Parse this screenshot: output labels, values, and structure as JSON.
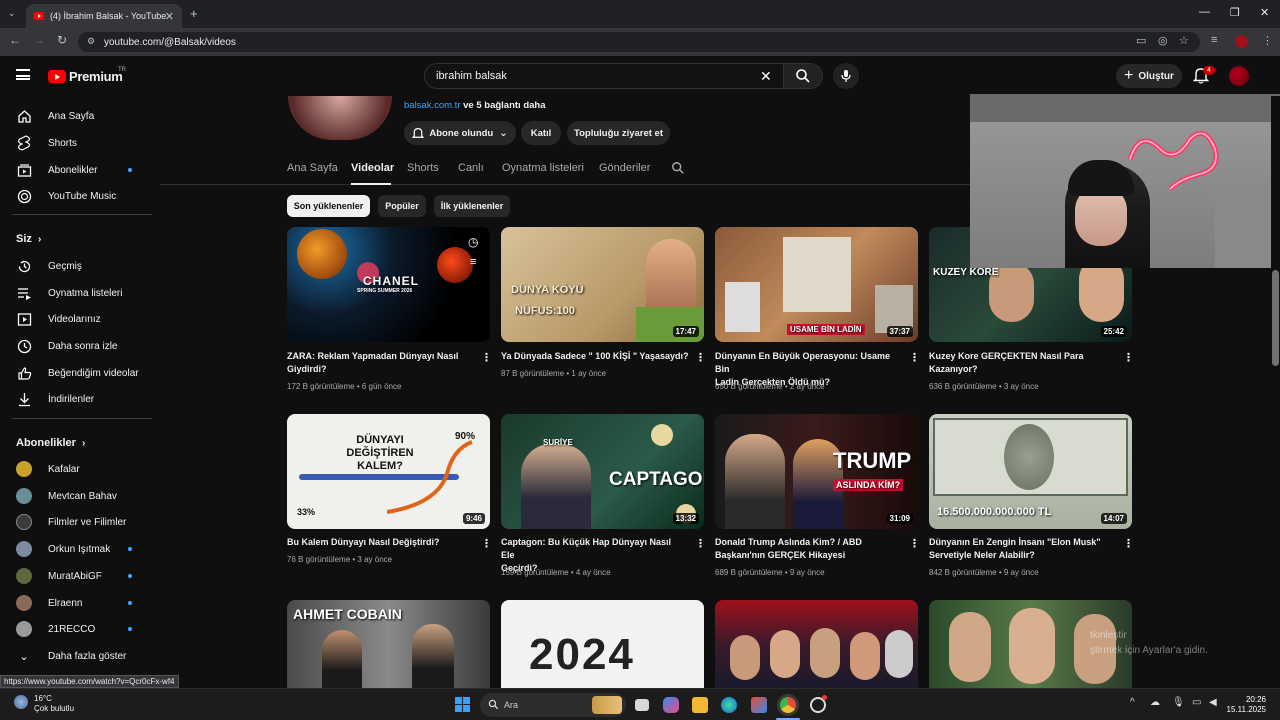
{
  "browser": {
    "tab_title": "(4) İbrahim Balsak - YouTube",
    "url": "youtube.com/@Balsak/videos",
    "status_url": "https://www.youtube.com/watch?v=Qcr0cFx-wf4"
  },
  "header": {
    "logo_text": "Premium",
    "logo_region": "TR",
    "search_value": "ibrahim balsak",
    "create_label": "Oluştur",
    "notification_count": "4"
  },
  "sidebar": {
    "main": [
      {
        "label": "Ana Sayfa",
        "icon": "home-icon"
      },
      {
        "label": "Shorts",
        "icon": "shorts-icon"
      },
      {
        "label": "Abonelikler",
        "icon": "subscriptions-icon"
      },
      {
        "label": "YouTube Music",
        "icon": "music-icon"
      }
    ],
    "you_heading": "Siz",
    "you": [
      {
        "label": "Geçmiş",
        "icon": "history-icon"
      },
      {
        "label": "Oynatma listeleri",
        "icon": "playlists-icon"
      },
      {
        "label": "Videolarınız",
        "icon": "your-videos-icon"
      },
      {
        "label": "Daha sonra izle",
        "icon": "watch-later-icon"
      },
      {
        "label": "Beğendiğim videolar",
        "icon": "liked-icon"
      },
      {
        "label": "İndirilenler",
        "icon": "downloads-icon"
      }
    ],
    "subs_heading": "Abonelikler",
    "subs": [
      {
        "label": "Kafalar",
        "color": "#c9a227"
      },
      {
        "label": "Mevtcan Bahav",
        "color": "#6a8f9a"
      },
      {
        "label": "Filmler ve Filimler",
        "color": "#3a3a3a"
      },
      {
        "label": "Orkun Işıtmak",
        "color": "#7a8ba0"
      },
      {
        "label": "MuratAbiGF",
        "color": "#5c6b3d"
      },
      {
        "label": "Elraenn",
        "color": "#8a6a5a"
      },
      {
        "label": "21RECCO",
        "color": "#9a9a9a"
      }
    ],
    "show_more": "Daha fazla göster"
  },
  "channel": {
    "link": "balsak.com.tr",
    "more_links": "ve 5 bağlantı daha",
    "subscribed_label": "Abone olundu",
    "join_label": "Katıl",
    "community_label": "Topluluğu ziyaret et",
    "tabs": [
      "Ana Sayfa",
      "Videolar",
      "Shorts",
      "Canlı",
      "Oynatma listeleri",
      "Gönderiler"
    ],
    "filters": [
      "Son yüklenenler",
      "Popüler",
      "İlk yüklenenler"
    ]
  },
  "videos": [
    {
      "title_l1": "ZARA: Reklam Yapmadan Dünyayı Nasıl",
      "title_l2": "Giydirdi?",
      "views": "172 B görüntüleme",
      "age": "6 gün önce",
      "duration": "",
      "thumb_text": "CHANEL",
      "thumb_sub": "SPRING SUMMER 2026"
    },
    {
      "title_l1": "Ya Dünyada Sadece \" 100 KİŞİ \" Yaşasaydı?",
      "title_l2": "",
      "views": "87 B görüntüleme",
      "age": "1 ay önce",
      "duration": "17:47",
      "thumb_text": "DÜNYA KÖYÜ",
      "thumb_sub": "NÜFUS:100"
    },
    {
      "title_l1": "Dünyanın En Büyük Operasyonu: Usame Bin",
      "title_l2": "Ladin Gerçekten Öldü mü?",
      "views": "650 B görüntüleme",
      "age": "2 ay önce",
      "duration": "37:37",
      "thumb_text": "USAME BİN LADİN",
      "thumb_sub": ""
    },
    {
      "title_l1": "Kuzey Kore GERÇEKTEN Nasıl Para",
      "title_l2": "Kazanıyor?",
      "views": "636 B görüntüleme",
      "age": "3 ay önce",
      "duration": "25:42",
      "thumb_text": "KUZEY KORE",
      "thumb_sub": ""
    },
    {
      "title_l1": "Bu Kalem Dünyayı Nasıl Değiştirdi?",
      "title_l2": "",
      "views": "76 B görüntüleme",
      "age": "3 ay önce",
      "duration": "9:46",
      "thumb_text": "DÜNYAYI DEĞİŞTİREN KALEM?",
      "thumb_sub": "90%"
    },
    {
      "title_l1": "Captagon: Bu Küçük Hap Dünyayı Nasıl Ele",
      "title_l2": "Geçirdi?",
      "views": "159 B görüntüleme",
      "age": "4 ay önce",
      "duration": "13:32",
      "thumb_text": "CAPTAGON",
      "thumb_sub": "SURİYE"
    },
    {
      "title_l1": "Donald Trump Aslında Kim? / ABD",
      "title_l2": "Başkanı'nın GERÇEK Hikayesi",
      "views": "689 B görüntüleme",
      "age": "9 ay önce",
      "duration": "31:09",
      "thumb_text": "TRUMP",
      "thumb_sub": "ASLINDA KİM?"
    },
    {
      "title_l1": "Dünyanın En Zengin İnsanı \"Elon Musk\"",
      "title_l2": "Servetiyle Neler Alabilir?",
      "views": "842 B görüntüleme",
      "age": "9 ay önce",
      "duration": "14:07",
      "thumb_text": "16.500.000.000.000 TL",
      "thumb_sub": ""
    },
    {
      "title_l1": "",
      "title_l2": "",
      "views": "",
      "age": "",
      "duration": "",
      "thumb_text": "AHMET COBAIN",
      "thumb_sub": ""
    },
    {
      "title_l1": "",
      "title_l2": "",
      "views": "",
      "age": "",
      "duration": "",
      "thumb_text": "2024",
      "thumb_sub": ""
    },
    {
      "title_l1": "",
      "title_l2": "",
      "views": "",
      "age": "",
      "duration": "",
      "thumb_text": "",
      "thumb_sub": ""
    },
    {
      "title_l1": "",
      "title_l2": "",
      "views": "",
      "age": "",
      "duration": "",
      "thumb_text": "",
      "thumb_sub": ""
    }
  ],
  "watermark": {
    "line1": "tkinleştir",
    "line2": "ştirmek için Ayarlar'a gidin."
  },
  "taskbar": {
    "temp": "16°C",
    "weather": "Çok bulutlu",
    "search_label": "Ara",
    "time": "20:26",
    "date": "15.11.2025"
  },
  "colors": {
    "accent": "#ff0000",
    "link": "#3ea6ff",
    "bg": "#0f0f0f"
  }
}
